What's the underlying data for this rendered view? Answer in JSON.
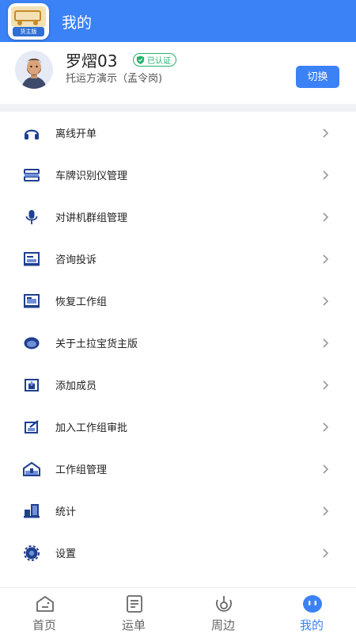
{
  "header": {
    "title": "我的",
    "logo_text": "货主版"
  },
  "profile": {
    "username": "罗熠03",
    "verified_badge": "已认证",
    "company": "托运方演示（孟令岗)",
    "switch_button": "切换"
  },
  "menu": {
    "items": [
      {
        "label": "离线开单",
        "icon": "headset-icon"
      },
      {
        "label": "车牌识别仪管理",
        "icon": "plate-scanner-icon"
      },
      {
        "label": "对讲机群组管理",
        "icon": "microphone-icon"
      },
      {
        "label": "咨询投诉",
        "icon": "document-icon"
      },
      {
        "label": "恢复工作组",
        "icon": "restore-icon"
      },
      {
        "label": "关于土拉宝货主版",
        "icon": "eye-icon"
      },
      {
        "label": "添加成员",
        "icon": "add-member-icon"
      },
      {
        "label": "加入工作组审批",
        "icon": "approve-icon"
      },
      {
        "label": "工作组管理",
        "icon": "house-icon"
      },
      {
        "label": "统计",
        "icon": "bar-chart-icon"
      },
      {
        "label": "设置",
        "icon": "gear-icon"
      }
    ]
  },
  "tabbar": {
    "tabs": [
      {
        "label": "首页",
        "icon": "home-icon",
        "active": false
      },
      {
        "label": "运单",
        "icon": "waybill-icon",
        "active": false
      },
      {
        "label": "周边",
        "icon": "nearby-icon",
        "active": false
      },
      {
        "label": "我的",
        "icon": "profile-face-icon",
        "active": true
      }
    ]
  },
  "colors": {
    "accent": "#3b82f6",
    "verified": "#23b26d",
    "icon": "#1f3f8f"
  }
}
